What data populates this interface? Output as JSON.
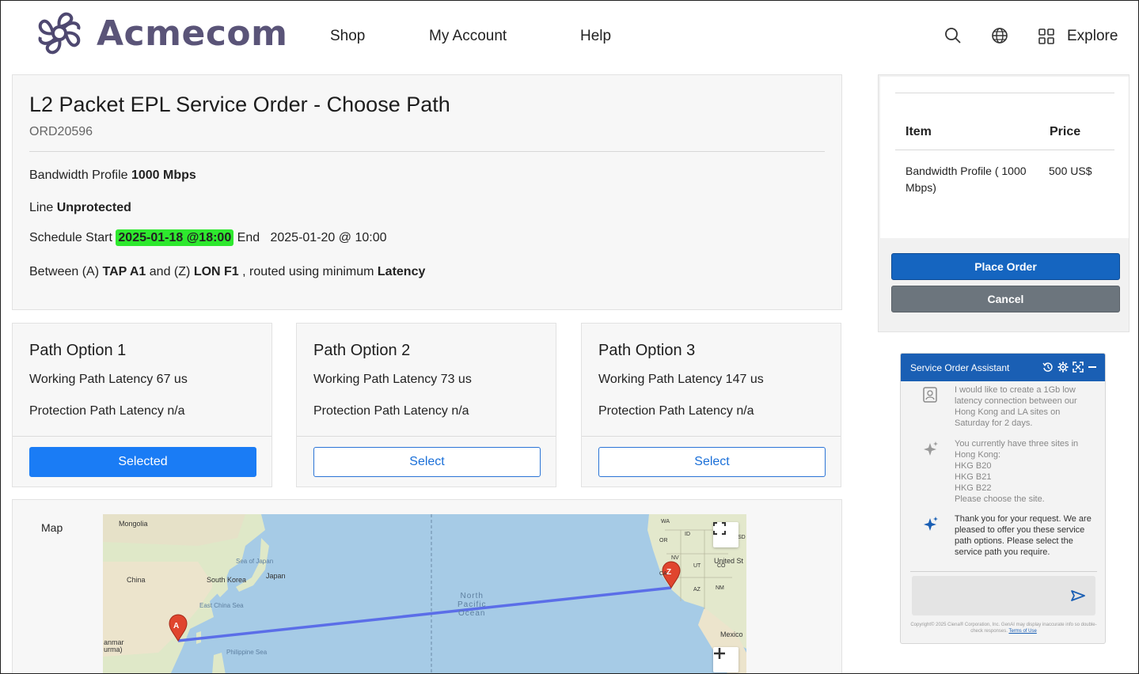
{
  "header": {
    "brand": "Acmecom",
    "nav": [
      "Shop",
      "My Account",
      "Help"
    ],
    "icons": [
      "search-icon",
      "globe-icon",
      "grid-icon"
    ],
    "explore_label": "Explore"
  },
  "order": {
    "title": "L2 Packet EPL Service Order - Choose Path",
    "order_id": "ORD20596",
    "bandwidth_label": "Bandwidth Profile",
    "bandwidth_value": "1000 Mbps",
    "line_label": "Line",
    "line_value": "Unprotected",
    "schedule_label": "Schedule Start",
    "schedule_start": "2025-01-18 @18:00",
    "end_label": "End",
    "schedule_end": "2025-01-20 @ 10:00",
    "between_label": "Between (A)",
    "site_a": "TAP A1",
    "and_label": "and (Z)",
    "site_z": "LON F1",
    "routed_label": ", routed using minimum",
    "routing_metric": "Latency",
    "highlight_color": "#2ee82e"
  },
  "paths": [
    {
      "title": "Path Option 1",
      "working": "Working Path Latency 67 us",
      "protection": "Protection Path Latency n/a",
      "button": "Selected",
      "selected": true
    },
    {
      "title": "Path Option 2",
      "working": "Working Path Latency 73 us",
      "protection": "Protection Path Latency n/a",
      "button": "Select",
      "selected": false
    },
    {
      "title": "Path Option 3",
      "working": "Working Path Latency 147 us",
      "protection": "Protection Path Latency n/a",
      "button": "Select",
      "selected": false
    }
  ],
  "map": {
    "label": "Map",
    "labels": [
      "Mongolia",
      "China",
      "South Korea",
      "Japan",
      "Sea of Japan",
      "East China Sea",
      "Philippine Sea",
      "anmar",
      "urma)",
      "WA",
      "OR",
      "ID",
      "SD",
      "NV",
      "UT",
      "AZ",
      "NM",
      "CO",
      "CA",
      "United St",
      "Mexico"
    ],
    "ocean": [
      "North",
      "Pacific",
      "Ocean"
    ],
    "marker_a": "A",
    "marker_z": "Z",
    "route_color": "#5b6ee8",
    "marker_color": "#e0452e"
  },
  "summary": {
    "col_item": "Item",
    "col_price": "Price",
    "row_item": "Bandwidth Profile ( 1000 Mbps)",
    "row_price": "500 US$",
    "place_order": "Place Order",
    "cancel": "Cancel"
  },
  "assistant": {
    "title": "Service Order Assistant",
    "messages": [
      {
        "role": "user",
        "icon": "user-icon",
        "text": "I would like to create a 1Gb low latency connection between our Hong Kong and LA sites on Saturday for 2 days."
      },
      {
        "role": "ai",
        "icon": "sparkle-icon",
        "text": "You currently have three sites in Hong Kong:\nHKG B20\nHKG B21\nHKG B22\nPlease choose the site."
      },
      {
        "role": "ai",
        "icon": "sparkle-icon",
        "text": "Thank you for your request.  We are pleased to offer you these service path options.  Please select the service path you require."
      }
    ],
    "footer": "Copyright© 2025 Ciena® Corporation, Inc. GenAI may display inaccurate info so double-check responses.",
    "footer_link": "Terms of Use"
  }
}
